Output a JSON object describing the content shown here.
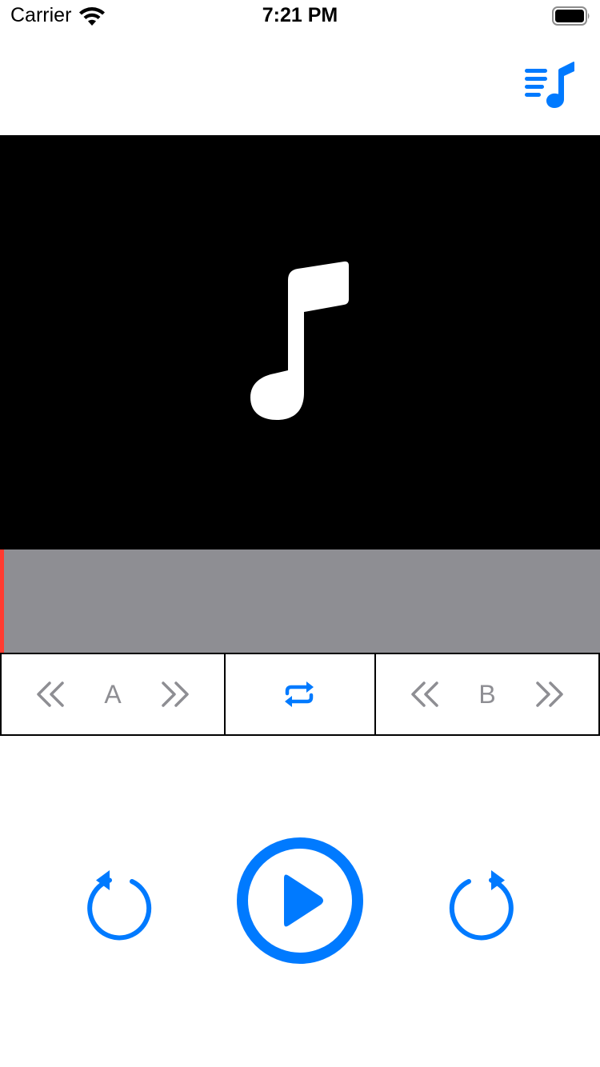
{
  "status_bar": {
    "carrier": "Carrier",
    "time": "7:21 PM",
    "wifi_icon": "wifi-icon",
    "battery_icon": "battery-full-icon"
  },
  "navbar": {
    "playlist_icon": "music-playlist-icon"
  },
  "artwork": {
    "icon": "music-note-icon",
    "background": "#000000"
  },
  "waveform": {
    "playhead_position": 0,
    "background": "#8e8e93",
    "playhead_color": "#ff3b30"
  },
  "ab_controls": {
    "point_a": {
      "label": "A",
      "back_icon": "chevron-double-left-icon",
      "forward_icon": "chevron-double-right-icon"
    },
    "loop_icon": "repeat-icon",
    "point_b": {
      "label": "B",
      "back_icon": "chevron-double-left-icon",
      "forward_icon": "chevron-double-right-icon"
    }
  },
  "playback": {
    "rewind_icon": "rotate-left-icon",
    "play_icon": "play-circle-icon",
    "forward_icon": "rotate-right-icon"
  },
  "colors": {
    "accent": "#007aff",
    "inactive": "#8e8e93",
    "border": "#000000"
  }
}
